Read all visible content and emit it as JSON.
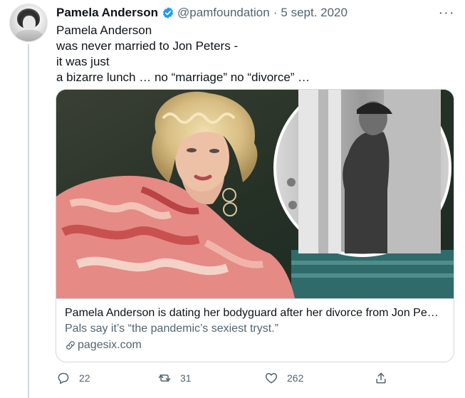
{
  "tweet": {
    "author": {
      "display_name": "Pamela Anderson",
      "handle": "@pamfoundation",
      "verified": true,
      "avatar_icon": "profile-photo"
    },
    "separator": "·",
    "date": "5 sept. 2020",
    "more_label": "···",
    "text_lines": [
      "Pamela Anderson",
      "was never married to Jon Peters -",
      "it was just",
      "a bizarre lunch … no “marriage” no “divorce” …"
    ],
    "card": {
      "title": "Pamela Anderson is dating her bodyguard after her divorce from Jon Pe…",
      "description": "Pals say it’s “the pandemic’s sexiest tryst.”",
      "domain": "pagesix.com"
    },
    "actions": {
      "replies": "22",
      "retweets": "31",
      "likes": "262"
    },
    "colors": {
      "accent": "#1d9bf0",
      "secondary_text": "#536471",
      "border": "#cfd9de"
    }
  }
}
